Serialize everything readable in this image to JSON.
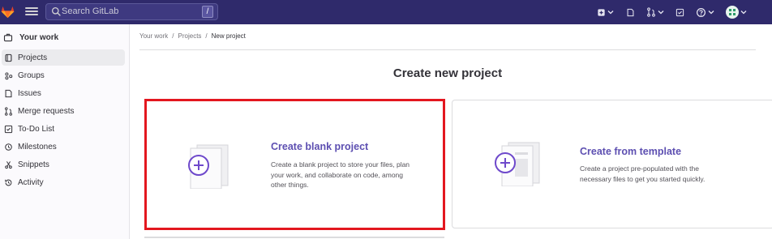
{
  "topbar": {
    "search_placeholder": "Search GitLab",
    "search_shortcut": "/"
  },
  "sidebar": {
    "header": "Your work",
    "items": [
      {
        "label": "Projects",
        "icon": "project-icon",
        "active": true
      },
      {
        "label": "Groups",
        "icon": "group-icon"
      },
      {
        "label": "Issues",
        "icon": "issues-icon"
      },
      {
        "label": "Merge requests",
        "icon": "merge-request-icon"
      },
      {
        "label": "To-Do List",
        "icon": "todo-icon"
      },
      {
        "label": "Milestones",
        "icon": "milestone-icon"
      },
      {
        "label": "Snippets",
        "icon": "snippet-icon"
      },
      {
        "label": "Activity",
        "icon": "history-icon"
      }
    ]
  },
  "breadcrumb": [
    "Your work",
    "Projects",
    "New project"
  ],
  "page_title": "Create new project",
  "cards": [
    {
      "title": "Create blank project",
      "desc": [
        "Create a blank project to store your files, plan",
        "your work, and collaborate on code, among",
        "other things."
      ]
    },
    {
      "title": "Create from template",
      "desc": [
        "Create a project pre-populated with the",
        "necessary files to get you started quickly."
      ]
    }
  ],
  "colors": {
    "accent": "#5d4fb1",
    "topbar": "#2f2a6b",
    "highlight": "#e3171f"
  }
}
